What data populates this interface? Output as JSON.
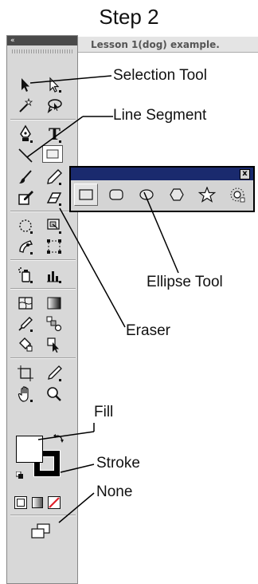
{
  "step_title": "Step 2",
  "panel": {
    "collapse_glyph": "«"
  },
  "document_tab": "Lesson 1(dog) example.",
  "flyout": {
    "close_glyph": "x",
    "tools": [
      "rectangle-icon",
      "rounded-rectangle-icon",
      "ellipse-icon",
      "polygon-icon",
      "star-icon",
      "flare-icon"
    ]
  },
  "callouts": {
    "selection_tool": "Selection Tool",
    "line_segment": "Line Segment",
    "ellipse_tool": "Ellipse Tool",
    "eraser": "Eraser",
    "fill": "Fill",
    "stroke": "Stroke",
    "none": "None"
  },
  "colors": {
    "panel_bg": "#d8d8d8",
    "flyout_titlebar": "#1a2a6e",
    "none_red": "#e0202a"
  }
}
